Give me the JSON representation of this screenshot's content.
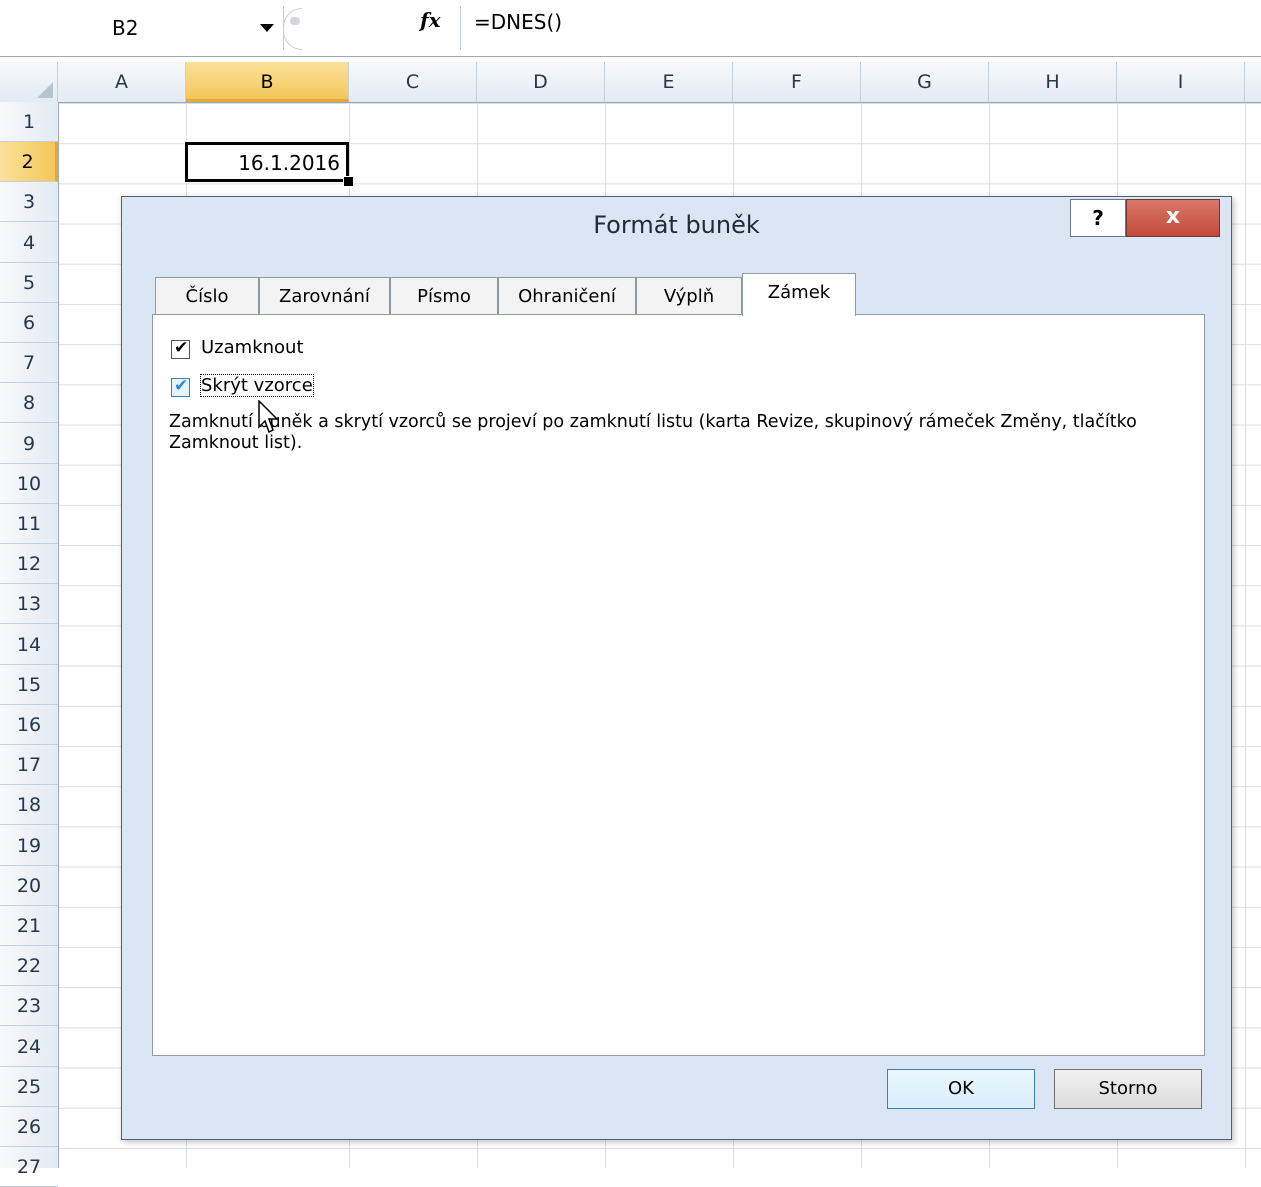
{
  "formula_bar": {
    "name_box": "B2",
    "fx_icon": "fx",
    "formula": "=DNES()"
  },
  "columns": [
    "A",
    "B",
    "C",
    "D",
    "E",
    "F",
    "G",
    "H",
    "I"
  ],
  "rows": [
    "1",
    "2",
    "3",
    "4",
    "5",
    "6",
    "7",
    "8",
    "9",
    "10",
    "11",
    "12",
    "13",
    "14",
    "15",
    "16",
    "17",
    "18",
    "19",
    "20",
    "21",
    "22",
    "23",
    "24",
    "25",
    "26",
    "27"
  ],
  "selected_column": "B",
  "selected_row": "2",
  "cell_b2": "16.1.2016",
  "dialog": {
    "title": "Formát buněk",
    "help": "?",
    "close": "x",
    "tabs": [
      "Číslo",
      "Zarovnání",
      "Písmo",
      "Ohraničení",
      "Výplň",
      "Zámek"
    ],
    "active_tab": "Zámek",
    "lock_label": "Uzamknout",
    "lock_checked": true,
    "hide_label": "Skrýt vzorce",
    "hide_checked": true,
    "info": "Zamknutí buněk a skrytí vzorců se projeví po zamknutí listu (karta Revize, skupinový rámeček Změny, tlačítko Zamknout list).",
    "ok": "OK",
    "cancel": "Storno"
  }
}
